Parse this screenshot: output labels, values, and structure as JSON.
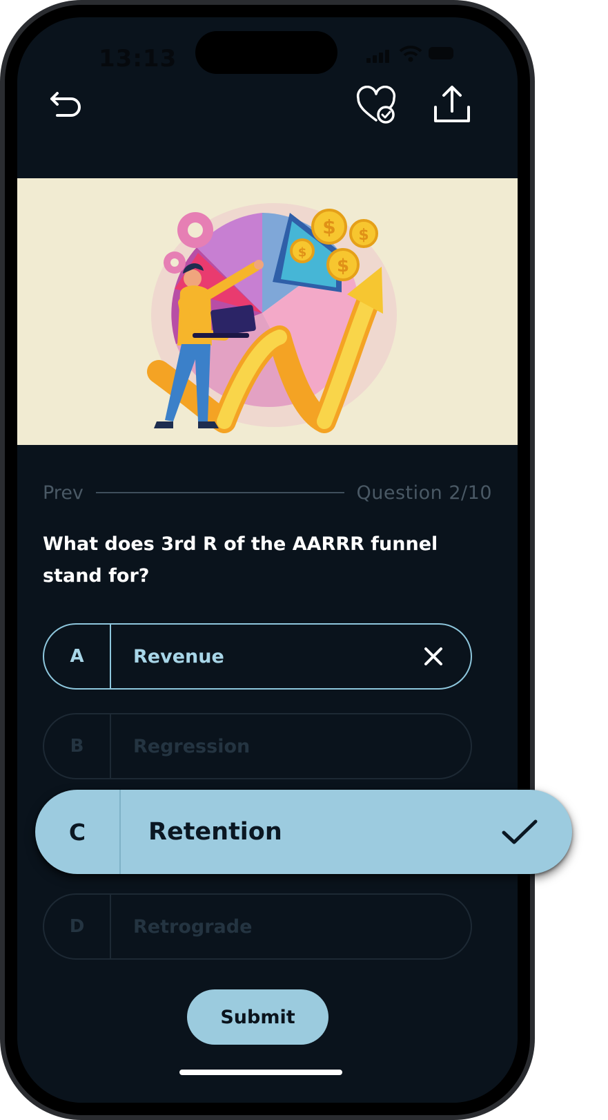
{
  "status_bar": {
    "time": "13:13"
  },
  "toolbar": {
    "back_icon": "undo-arrow-icon",
    "favorite_icon": "heart-check-icon",
    "share_icon": "share-upload-icon"
  },
  "hero": {
    "illustration": "business-growth-chart-illustration"
  },
  "progress": {
    "prev_label": "Prev",
    "counter": "Question 2/10"
  },
  "question": {
    "text": "What does 3rd R of the AARRR funnel stand for?"
  },
  "options": [
    {
      "letter": "A",
      "text": "Revenue",
      "state": "incorrect"
    },
    {
      "letter": "B",
      "text": "Regression",
      "state": "disabled"
    },
    {
      "letter": "C",
      "text": "Retention",
      "state": "correct"
    },
    {
      "letter": "D",
      "text": "Retrograde",
      "state": "disabled"
    }
  ],
  "submit": {
    "label": "Submit"
  },
  "colors": {
    "background": "#0a131c",
    "accent": "#9bcbde",
    "hero_bg": "#f1ebd2"
  }
}
